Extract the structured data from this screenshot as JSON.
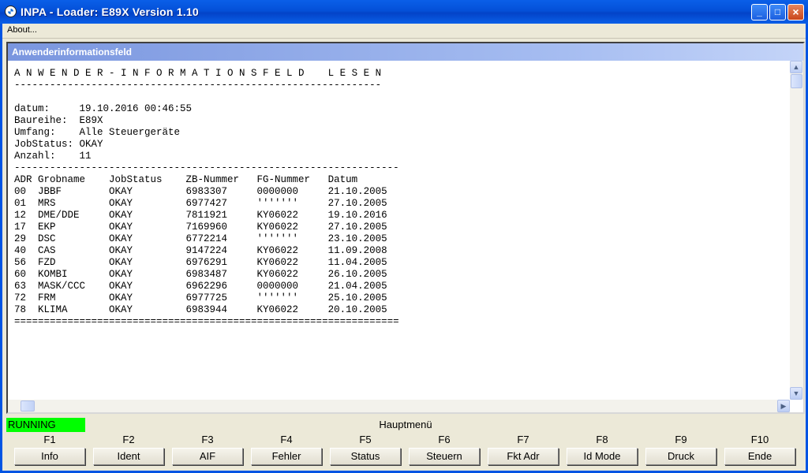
{
  "window": {
    "title": "INPA - Loader:  E89X Version 1.10"
  },
  "titlebar_buttons": {
    "minimize": "_",
    "maximize": "□",
    "close": "×"
  },
  "menu": {
    "about": "About..."
  },
  "panel": {
    "title": "Anwenderinformationsfeld",
    "text": "A N W E N D E R - I N F O R M A T I O N S F E L D    L E S E N\n--------------------------------------------------------------\n\ndatum:     19.10.2016 00:46:55\nBaureihe:  E89X\nUmfang:    Alle Steuergeräte\nJobStatus: OKAY\nAnzahl:    11\n-----------------------------------------------------------------\nADR Grobname    JobStatus    ZB-Nummer   FG-Nummer   Datum\n00  JBBF        OKAY         6983307     0000000     21.10.2005\n01  MRS         OKAY         6977427     '''''''     27.10.2005\n12  DME/DDE     OKAY         7811921     KY06022     19.10.2016\n17  EKP         OKAY         7169960     KY06022     27.10.2005\n29  DSC         OKAY         6772214     '''''''     23.10.2005\n40  CAS         OKAY         9147224     KY06022     11.09.2008\n56  FZD         OKAY         6976291     KY06022     11.04.2005\n60  KOMBI       OKAY         6983487     KY06022     26.10.2005\n63  MASK/CCC    OKAY         6962296     0000000     21.04.2005\n72  FRM         OKAY         6977725     '''''''     25.10.2005\n78  KLIMA       OKAY         6983944     KY06022     20.10.2005\n================================================================="
  },
  "scrollbar_glyphs": {
    "up": "▲",
    "down": "▼",
    "left": "◀",
    "right": "▶"
  },
  "status": {
    "running": "RUNNING",
    "menu_title": "Hauptmenü"
  },
  "fkeys": [
    {
      "key": "F1",
      "label": "Info"
    },
    {
      "key": "F2",
      "label": "Ident"
    },
    {
      "key": "F3",
      "label": "AIF"
    },
    {
      "key": "F4",
      "label": "Fehler"
    },
    {
      "key": "F5",
      "label": "Status"
    },
    {
      "key": "F6",
      "label": "Steuern"
    },
    {
      "key": "F7",
      "label": "Fkt Adr"
    },
    {
      "key": "F8",
      "label": "Id Mode"
    },
    {
      "key": "F9",
      "label": "Druck"
    },
    {
      "key": "F10",
      "label": "Ende"
    }
  ],
  "colors": {
    "running_bg": "#00ff00",
    "titlebar": "#0450d8",
    "panel_header": "#7a96df"
  }
}
